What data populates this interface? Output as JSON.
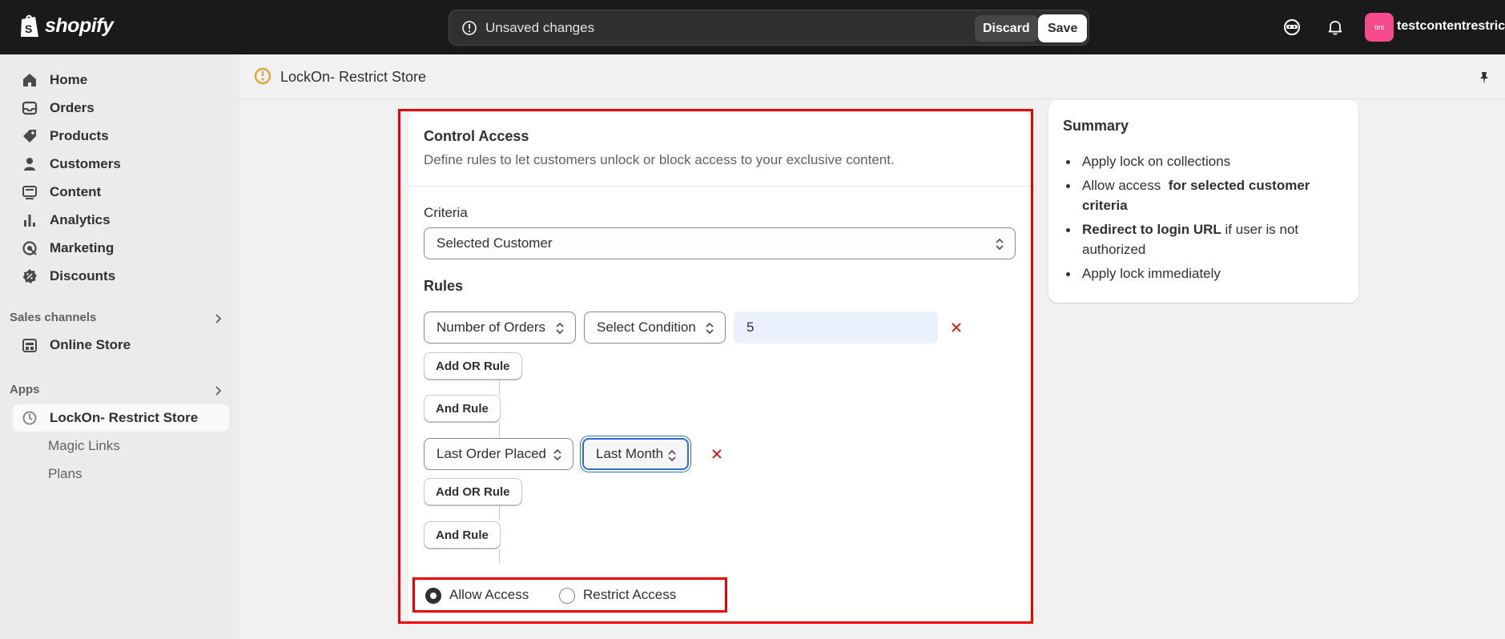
{
  "topbar": {
    "logo_text": "shopify",
    "unsaved_text": "Unsaved changes",
    "discard_label": "Discard",
    "save_label": "Save",
    "avatar_initials": "tes",
    "store_name": "testcontentrestriction",
    "avatar_color": "#f54a8c"
  },
  "sidebar": {
    "items": [
      {
        "label": "Home",
        "icon": "home-icon"
      },
      {
        "label": "Orders",
        "icon": "inbox-icon"
      },
      {
        "label": "Products",
        "icon": "tag-icon"
      },
      {
        "label": "Customers",
        "icon": "person-icon"
      },
      {
        "label": "Content",
        "icon": "content-icon"
      },
      {
        "label": "Analytics",
        "icon": "bar-chart-icon"
      },
      {
        "label": "Marketing",
        "icon": "target-icon"
      },
      {
        "label": "Discounts",
        "icon": "discount-icon"
      }
    ],
    "sales_channels_label": "Sales channels",
    "online_store_label": "Online Store",
    "apps_label": "Apps",
    "app_item_label": "LockOn- Restrict Store",
    "sub_items": [
      "Magic Links",
      "Plans"
    ]
  },
  "header": {
    "title": "LockOn- Restrict Store"
  },
  "card": {
    "title": "Control Access",
    "description": "Define rules to let customers unlock or block access to your exclusive content.",
    "criteria_label": "Criteria",
    "criteria_value": "Selected Customer",
    "rules_label": "Rules",
    "rule1": {
      "field": "Number of Orders",
      "condition": "Select Condition",
      "value": "5"
    },
    "rule2": {
      "field": "Last Order Placed",
      "condition": "Last Month"
    },
    "add_or_rule": "Add OR Rule",
    "and_rule": "And Rule",
    "allow_access": "Allow Access",
    "restrict_access": "Restrict Access",
    "selected_access": "Allow Access"
  },
  "summary": {
    "title": "Summary",
    "item1": "Apply lock on collections",
    "item2_prefix": "Allow access ",
    "item2_bold": "for selected customer criteria",
    "item3_bold": "Redirect to login URL",
    "item3_suffix": " if user is not authorized",
    "item4": "Apply lock immediately"
  },
  "colors": {
    "highlight": "#ee0000",
    "remove_icon": "#cc2222",
    "focus": "#2c6ecb",
    "input_bg": "#ebf0fd"
  }
}
